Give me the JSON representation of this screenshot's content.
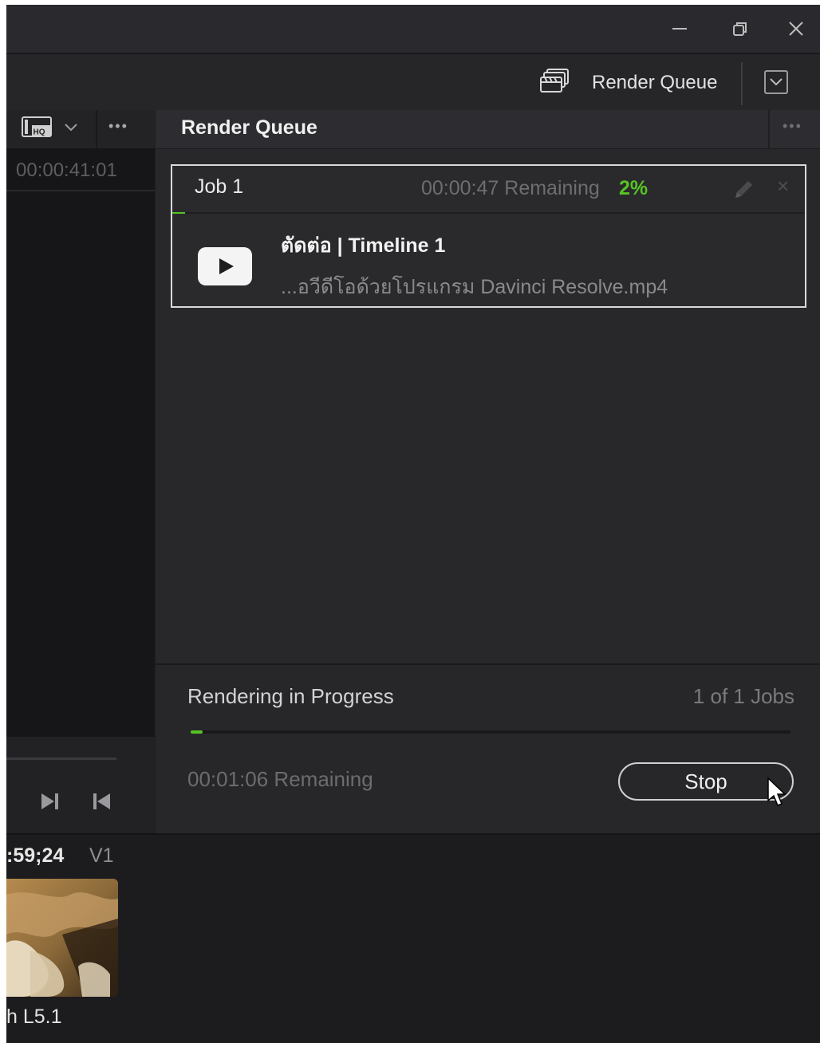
{
  "window": {
    "minimize_icon": "minimize-icon",
    "restore_icon": "restore-icon",
    "close_icon": "close-icon"
  },
  "toolbar": {
    "render_queue_label": "Render Queue",
    "render_queue_icon": "clapperboard-stack-icon",
    "dropdown_icon": "chevron-down-box-icon"
  },
  "viewer": {
    "quality_icon": "hq-monitor-icon",
    "timecode": "00:00:41:01",
    "transport": [
      "next-frame-icon",
      "prev-frame-icon"
    ]
  },
  "render_queue": {
    "title": "Render Queue",
    "job": {
      "name": "Job 1",
      "remaining": "00:00:47 Remaining",
      "percent": "2%",
      "progress": 0.02,
      "title_line": "ตัดต่อ | Timeline 1",
      "file_line": "...อวีดีโอด้วยโปรแกรม Davinci Resolve.mp4",
      "output_icon": "youtube-icon"
    },
    "footer": {
      "status": "Rendering in Progress",
      "jobs_count": "1 of 1 Jobs",
      "progress": 0.02,
      "remaining": "00:01:06 Remaining",
      "stop_label": "Stop"
    }
  },
  "media": {
    "timecode": ":59;24",
    "track": "V1",
    "audio": "h L5.1"
  },
  "colors": {
    "accent_green": "#56c424",
    "background": "#1f1f22",
    "panel": "#28282b"
  }
}
